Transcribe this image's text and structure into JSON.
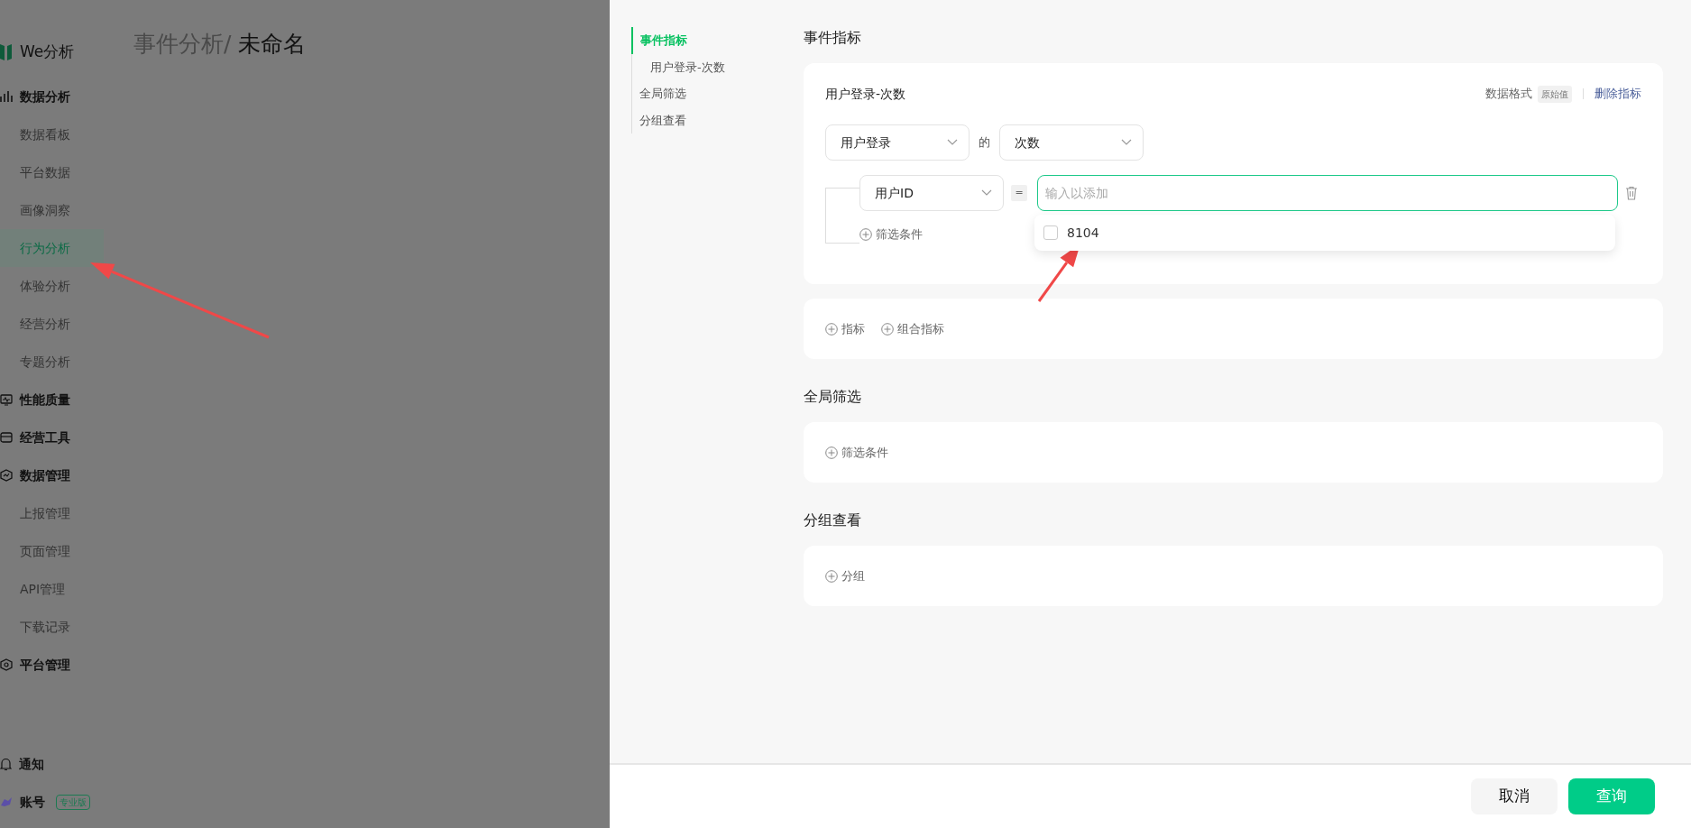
{
  "sidebar": {
    "logo": "We分析",
    "groups": [
      {
        "label": "数据分析",
        "children": [
          {
            "label": "数据看板",
            "selected": false
          },
          {
            "label": "平台数据",
            "selected": false
          },
          {
            "label": "画像洞察",
            "selected": false
          },
          {
            "label": "行为分析",
            "selected": true
          },
          {
            "label": "体验分析",
            "selected": false
          },
          {
            "label": "经营分析",
            "selected": false
          },
          {
            "label": "专题分析",
            "selected": false
          }
        ]
      },
      {
        "label": "性能质量"
      },
      {
        "label": "经营工具"
      },
      {
        "label": "数据管理",
        "children": [
          {
            "label": "上报管理",
            "selected": false
          },
          {
            "label": "页面管理",
            "selected": false
          },
          {
            "label": "API管理",
            "selected": false
          },
          {
            "label": "下载记录",
            "selected": false
          }
        ]
      },
      {
        "label": "平台管理"
      }
    ],
    "bottom": [
      {
        "label": "通知"
      },
      {
        "label": "账号",
        "badge": "专业版"
      }
    ]
  },
  "header": {
    "breadcrumb": "事件分析/",
    "title": "未命名"
  },
  "anchors": [
    {
      "label": "事件指标",
      "selected": true,
      "children": [
        {
          "label": "用户登录-次数",
          "selected": false
        }
      ]
    },
    {
      "label": "全局筛选",
      "selected": false
    },
    {
      "label": "分组查看",
      "selected": false
    }
  ],
  "metrics_section": {
    "title": "事件指标",
    "metric": {
      "name": "用户登录-次数",
      "format_label": "数据格式",
      "format_value": "原始值",
      "delete": "删除指标",
      "event": "用户登录",
      "connector": "的",
      "measure": "次数",
      "filter": {
        "property": "用户ID",
        "operator": "=",
        "placeholder": "输入以添加",
        "options": [
          {
            "label": "8104",
            "checked": false
          }
        ]
      },
      "add_filter": "筛选条件"
    },
    "actions": [
      "指标",
      "组合指标"
    ]
  },
  "global_filter": {
    "title": "全局筛选",
    "action": "筛选条件"
  },
  "group_by": {
    "title": "分组查看",
    "action": "分组"
  },
  "footer": {
    "buttons": [
      {
        "label": "取消",
        "kind": "secondary"
      },
      {
        "label": "查询",
        "kind": "primary"
      }
    ]
  }
}
